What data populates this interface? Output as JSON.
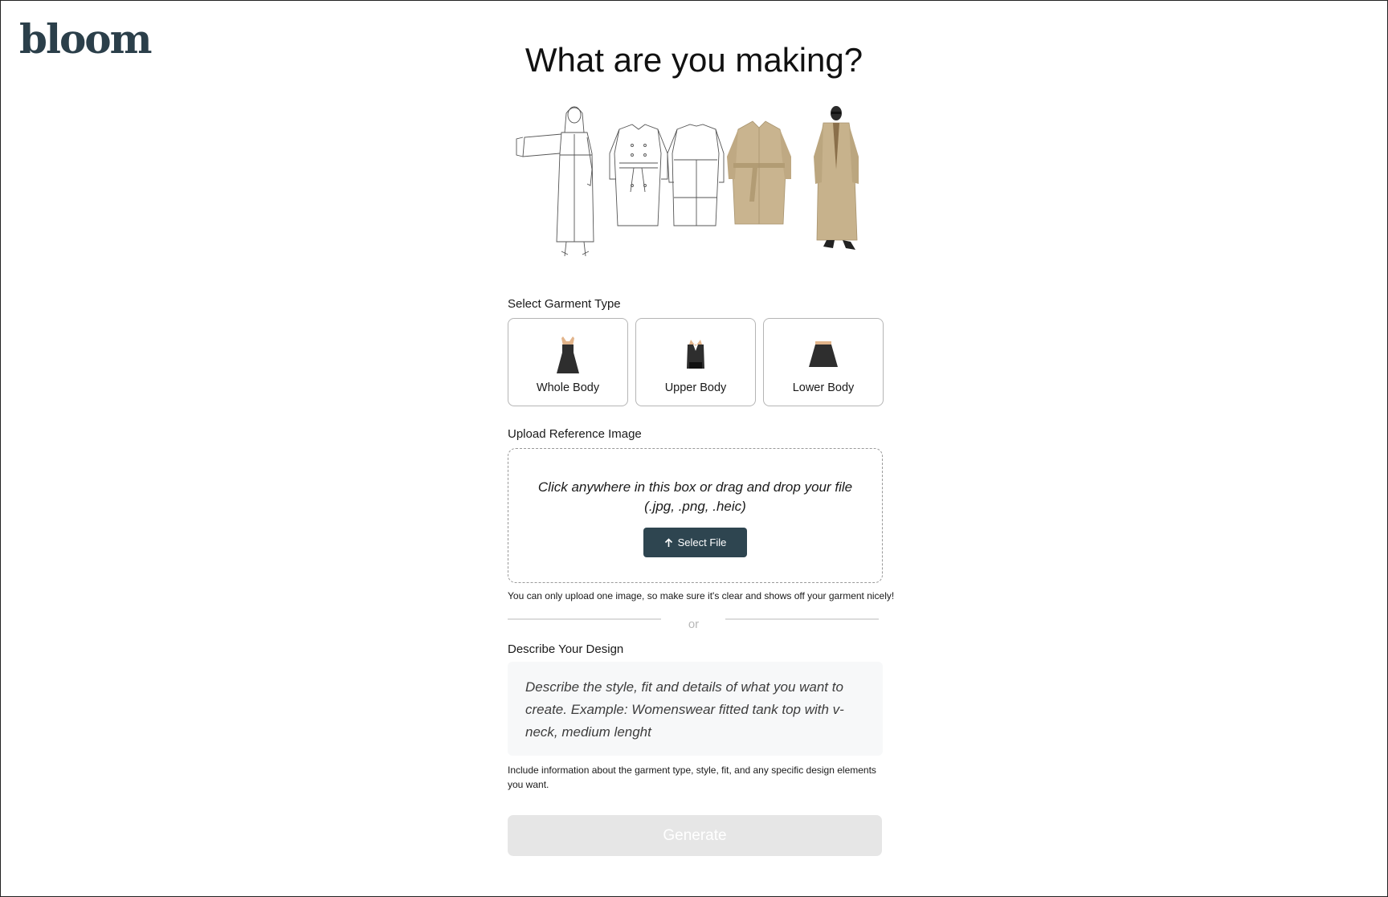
{
  "brand": {
    "logo_text": "bloom"
  },
  "header": {
    "title": "What are you making?"
  },
  "hero": {
    "description": "trench coat sketch to model progression",
    "icon": "garment-progression-illustration"
  },
  "garment_type": {
    "label": "Select Garment Type",
    "options": [
      {
        "label": "Whole Body",
        "icon": "dress-icon"
      },
      {
        "label": "Upper Body",
        "icon": "top-icon"
      },
      {
        "label": "Lower Body",
        "icon": "skirt-icon"
      }
    ]
  },
  "upload": {
    "label": "Upload Reference Image",
    "instruction_line1": "Click anywhere in this box or drag and drop your file",
    "instruction_line2": "(.jpg, .png, .heic)",
    "button_label": "Select File",
    "button_icon": "arrow-up-icon",
    "hint": "You can only upload one image, so make sure it's clear and shows off your garment nicely!"
  },
  "separator": {
    "text": "or"
  },
  "design": {
    "label": "Describe Your Design",
    "placeholder": "Describe the style, fit and details of what you want to create. Example: Womenswear fitted tank top with v-neck, medium lenght",
    "value": "",
    "hint": "Include information about the garment type, style, fit, and any specific design elements you want."
  },
  "actions": {
    "generate_label": "Generate",
    "generate_enabled": false
  },
  "colors": {
    "brand_dark": "#2e4550",
    "logo": "#2b3f4a",
    "disabled_button": "#e6e6e6",
    "coat_beige": "#c9b48f"
  }
}
